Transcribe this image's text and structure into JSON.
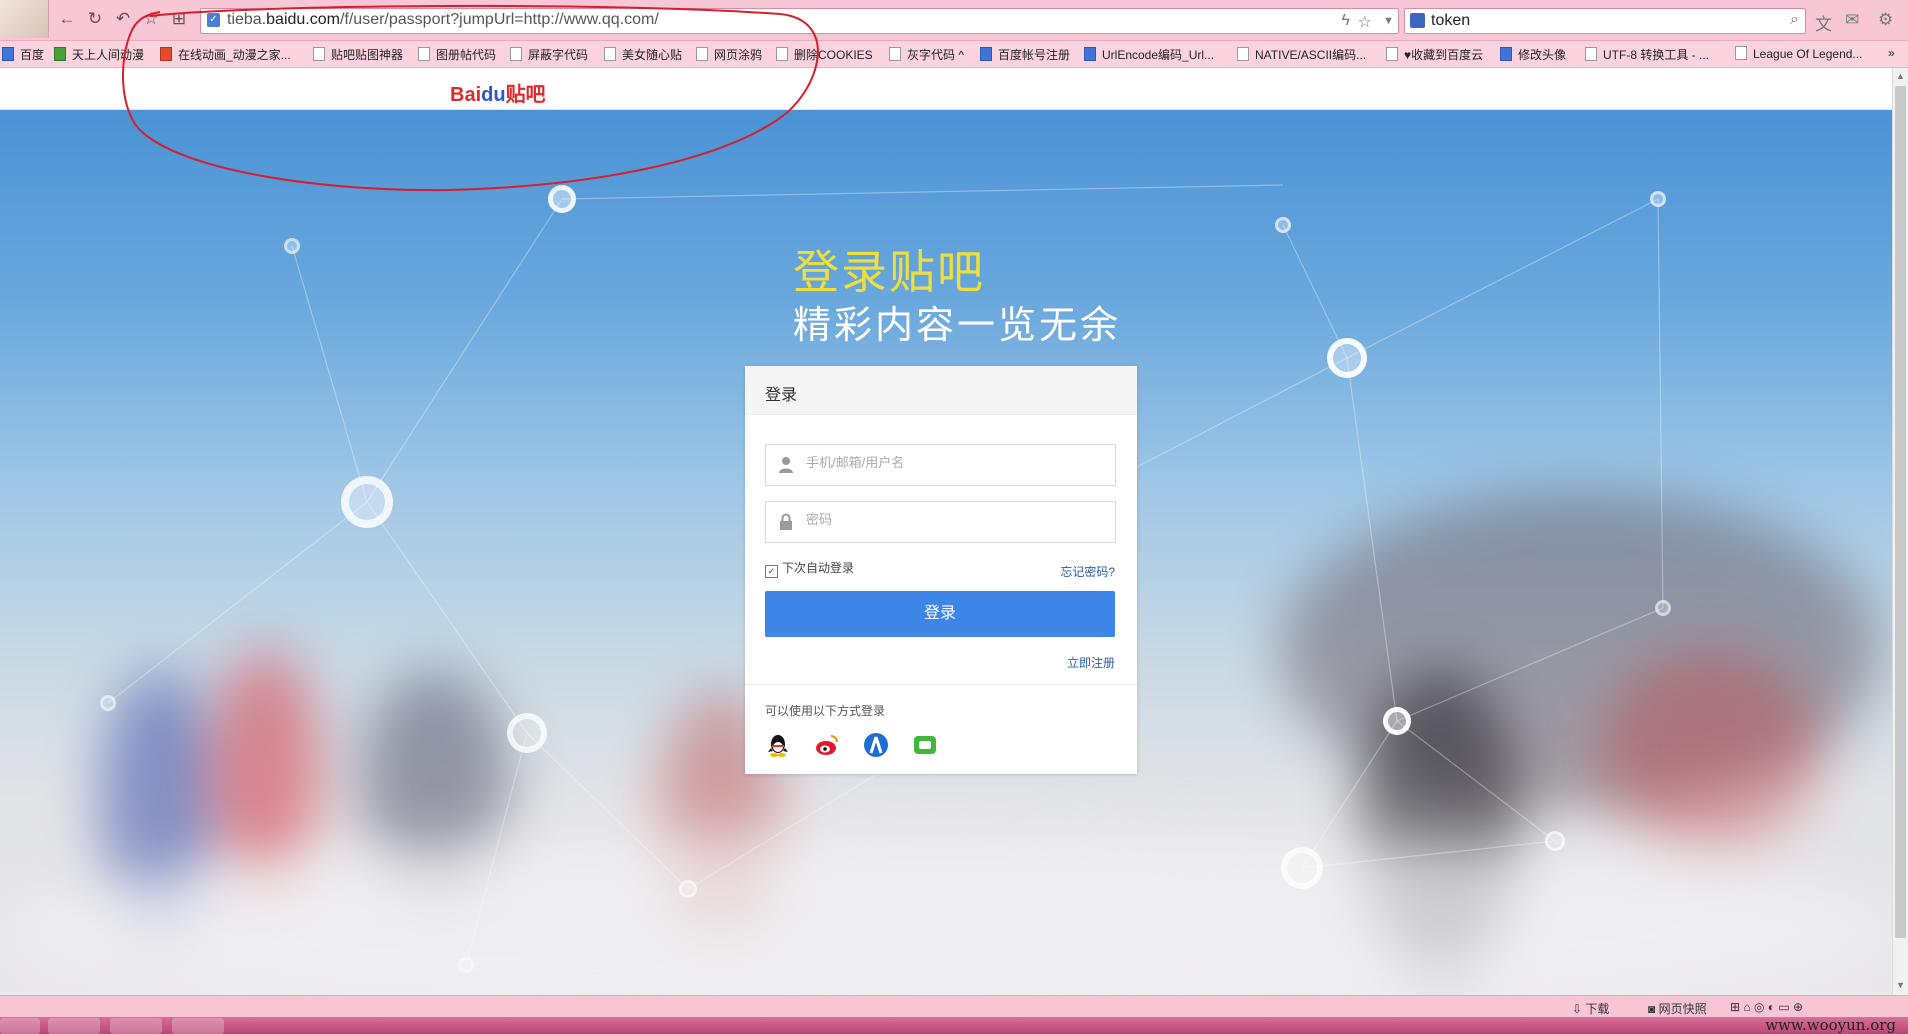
{
  "browser": {
    "url_prefix": "tieba.",
    "url_host": "baidu.com",
    "url_path": "/f/user/passport?jumpUrl=http://www.qq.com/",
    "search_text": "token",
    "bookmarks": [
      "百度",
      "天上人间动漫",
      "在线动画_动漫之家...",
      "贴吧贴图神器",
      "图册帖代码",
      "屏蔽字代码",
      "美女随心贴",
      "网页涂鸦",
      "删除COOKIES",
      "灰字代码 ^",
      "百度帐号注册",
      "UrlEncode编码_Url...",
      "NATIVE/ASCII编码...",
      "♥收藏到百度云",
      "修改头像",
      "UTF-8 转换工具 - ...",
      "League Of Legend..."
    ],
    "status": {
      "download": "下载",
      "snapshot": "网页快照"
    }
  },
  "page": {
    "logo_bai": "Bai",
    "logo_du": "du",
    "logo_tieba": "贴吧",
    "slogan_title": "登录贴吧",
    "slogan_sub": "精彩内容一览无余"
  },
  "login": {
    "title": "登录",
    "username_placeholder": "手机/邮箱/用户名",
    "password_placeholder": "密码",
    "remember_label": "下次自动登录",
    "forgot_label": "忘记密码?",
    "submit_label": "登录",
    "register_label": "立即注册",
    "alt_login_label": "可以使用以下方式登录"
  },
  "watermark": "www.wooyun.org",
  "colors": {
    "accent": "#3e85e8",
    "slogan": "#f0df3a",
    "annotation": "#d81e2a",
    "chrome": "#f7c7d6"
  }
}
